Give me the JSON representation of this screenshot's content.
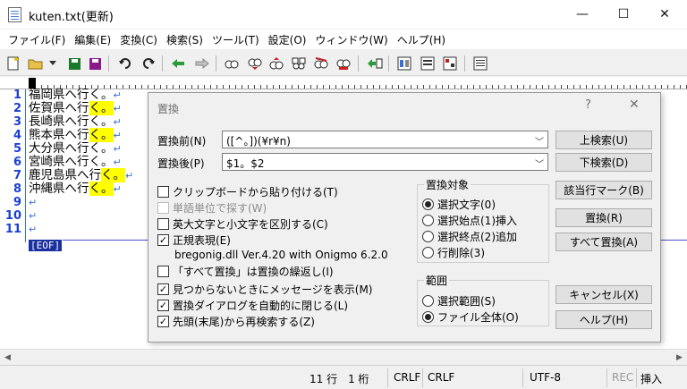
{
  "window": {
    "title": "kuten.txt(更新)",
    "minimize": "—",
    "maximize": "☐",
    "close": "✕"
  },
  "menu": [
    "ファイル(F)",
    "編集(E)",
    "変換(C)",
    "検索(S)",
    "ツール(T)",
    "設定(O)",
    "ウィンドウ(W)",
    "ヘルプ(H)"
  ],
  "editor": {
    "line_numbers": [
      "1",
      "2",
      "3",
      "4",
      "5",
      "6",
      "7",
      "8",
      "9",
      "10",
      "11"
    ],
    "lines": [
      {
        "text": "福岡県へ行く。",
        "hl": ""
      },
      {
        "text": "佐賀県へ行",
        "hl": "く。"
      },
      {
        "text": "長崎県へ行く。",
        "hl": ""
      },
      {
        "text": "熊本県へ行",
        "hl": "く。"
      },
      {
        "text": "大分県へ行く。",
        "hl": ""
      },
      {
        "text": "宮崎県へ行く。",
        "hl": ""
      },
      {
        "text": "鹿児島県へ行",
        "hl": "く。"
      },
      {
        "text": "沖縄県へ行",
        "hl": "く。"
      },
      {
        "text": "",
        "hl": ""
      },
      {
        "text": "",
        "hl": ""
      },
      {
        "text": "",
        "hl": ""
      }
    ],
    "newline_mark": "↵",
    "eof": "[EOF]"
  },
  "dialog": {
    "title": "置換",
    "help": "?",
    "close": "✕",
    "find_label": "置換前(N)",
    "find_value": "([^。])(¥r¥n)",
    "replace_label": "置換後(P)",
    "replace_value": "$1。$2",
    "checkboxes": [
      {
        "label": "クリップボードから貼り付ける(T)",
        "checked": false,
        "disabled": false
      },
      {
        "label": "単語単位で探す(W)",
        "checked": false,
        "disabled": true
      },
      {
        "label": "英大文字と小文字を区別する(C)",
        "checked": false,
        "disabled": false
      },
      {
        "label": "正規表現(E)",
        "checked": true,
        "disabled": false
      },
      {
        "label": "「すべて置換」は置換の繰返し(I)",
        "checked": false,
        "disabled": false
      },
      {
        "label": "見つからないときにメッセージを表示(M)",
        "checked": true,
        "disabled": false
      },
      {
        "label": "置換ダイアログを自動的に閉じる(L)",
        "checked": true,
        "disabled": false
      },
      {
        "label": "先頭(末尾)から再検索する(Z)",
        "checked": true,
        "disabled": false
      }
    ],
    "regex_info": "bregonig.dll Ver.4.20 with Onigmo 6.2.0",
    "target_group": {
      "title": "置換対象",
      "options": [
        {
          "label": "選択文字(0)",
          "selected": true
        },
        {
          "label": "選択始点(1)挿入",
          "selected": false
        },
        {
          "label": "選択終点(2)追加",
          "selected": false
        },
        {
          "label": "行削除(3)",
          "selected": false
        }
      ]
    },
    "range_group": {
      "title": "範囲",
      "options": [
        {
          "label": "選択範囲(S)",
          "selected": false
        },
        {
          "label": "ファイル全体(O)",
          "selected": true
        }
      ]
    },
    "buttons": {
      "search_up": "上検索(U)",
      "search_down": "下検索(D)",
      "mark_lines": "該当行マーク(B)",
      "replace": "置換(R)",
      "replace_all": "すべて置換(A)",
      "cancel": "キャンセル(X)",
      "help": "ヘルプ(H)"
    }
  },
  "status": {
    "position": "11 行　1 桁",
    "eol1": "CRLF",
    "eol2": "CRLF",
    "encoding": "UTF-8",
    "rec": "REC",
    "insert": "挿入"
  }
}
